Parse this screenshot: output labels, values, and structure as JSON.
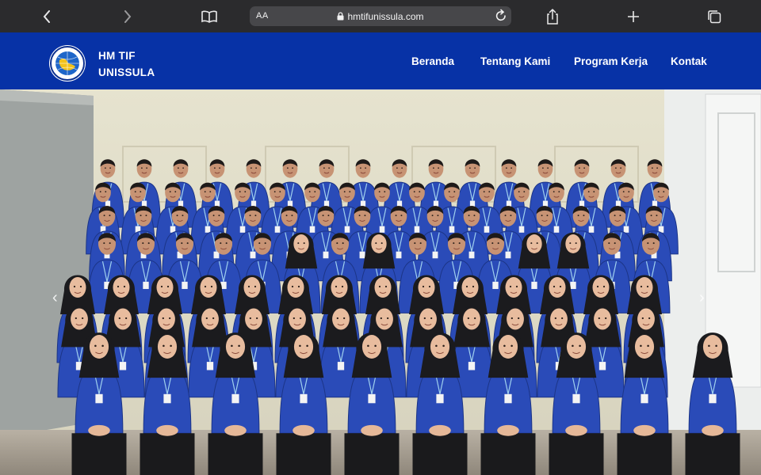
{
  "browser": {
    "reader_label": "AA",
    "url": "hmtifunissula.com",
    "icons": [
      "back-icon",
      "forward-icon",
      "book-icon",
      "lock-icon",
      "reload-icon",
      "share-icon",
      "plus-icon",
      "tabs-icon"
    ]
  },
  "site": {
    "brand_line1": "HM TIF",
    "brand_line2": "UNISSULA",
    "nav": [
      "Beranda",
      "Tentang Kami",
      "Program Kerja",
      "Kontak"
    ]
  },
  "hero": {
    "prev_label": "‹",
    "next_label": "›"
  },
  "colors": {
    "toolbar_bg": "#2b2b2d",
    "header_bg": "#0732a6",
    "uniform_blue": "#2a4bb8"
  }
}
